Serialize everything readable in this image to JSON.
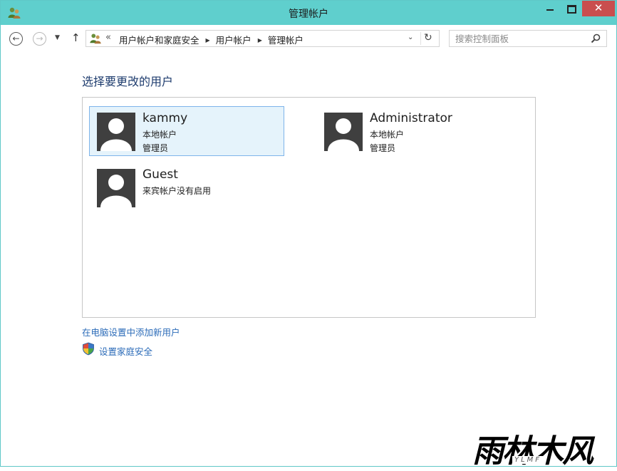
{
  "window": {
    "title": "管理帐户",
    "controls": {
      "minimize": "minimize",
      "maximize": "maximize",
      "close": "✕"
    },
    "colors": {
      "title_bar": "#5fcfcd",
      "close_button": "#c94e4e"
    }
  },
  "nav": {
    "back_icon": "back-arrow-icon",
    "forward_icon": "forward-arrow-icon",
    "recent_icon": "chevron-down-icon",
    "up_icon": "up-arrow-icon",
    "up_glyph": "↑",
    "back_glyph": "←",
    "forward_glyph": "→",
    "recent_glyph": "▼"
  },
  "address": {
    "overflow": "«",
    "crumbs": [
      "用户帐户和家庭安全",
      "用户帐户",
      "管理帐户"
    ],
    "separator": "▶",
    "dropdown": "⌄",
    "refresh": "↻"
  },
  "search": {
    "placeholder": "搜索控制面板",
    "value": ""
  },
  "main": {
    "heading": "选择要更改的用户",
    "users": [
      {
        "name": "kammy",
        "line1": "本地帐户",
        "line2": "管理员",
        "selected": true
      },
      {
        "name": "Administrator",
        "line1": "本地帐户",
        "line2": "管理员",
        "selected": false
      },
      {
        "name": "Guest",
        "line1": "来宾帐户没有启用",
        "line2": "",
        "selected": false
      }
    ],
    "add_user_link": "在电脑设置中添加新用户",
    "family_safety_link": "设置家庭安全"
  },
  "watermark": {
    "logo_text": "雨林木风",
    "sub_text": "YLMF"
  },
  "colors": {
    "link": "#2b6bb8",
    "heading": "#1e3c6e",
    "selected_tile_bg": "#e5f3fb",
    "selected_tile_border": "#7eb4ea"
  }
}
